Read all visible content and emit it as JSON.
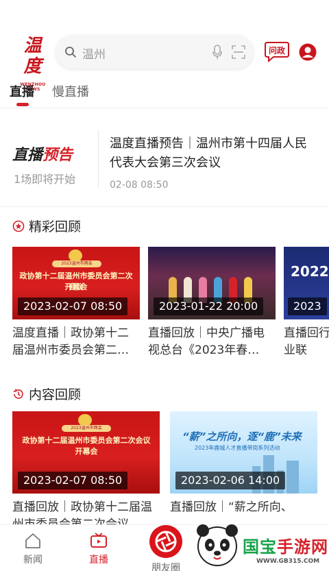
{
  "header": {
    "logo_text": "温度",
    "logo_sub": "WENZHOU NEWS",
    "search_placeholder": "温州",
    "wenzheng_label": "问政"
  },
  "tabs": [
    {
      "label": "直播",
      "active": true
    },
    {
      "label": "慢直播",
      "active": false
    }
  ],
  "notice": {
    "badge_part1": "直播",
    "badge_part2": "预告",
    "subtitle": "1场即将开始",
    "title": "温度直播预告｜温州市第十四届人民代表大会第三次会议",
    "time": "02-08  08:50"
  },
  "section_highlights": {
    "title": "精彩回顾",
    "cards": [
      {
        "thumb_line1": "政协第十二届温州市委员会第二次会议",
        "thumb_line2": "开幕会",
        "pill": "2023温州市两会",
        "timestamp": "2023-02-07  08:50",
        "title": "温度直播｜政协第十二届温州市委员会第二…"
      },
      {
        "timestamp": "2023-01-22  20:00",
        "title": "直播回放｜中央广播电视总台《2023年春…"
      },
      {
        "thumb_year": "2022",
        "timestamp": "2023",
        "title": "直播回行业联"
      }
    ]
  },
  "section_content": {
    "title": "内容回顾",
    "cards": [
      {
        "thumb_line1": "政协第十二届温州市委员会第二次会议",
        "thumb_line2": "开幕会",
        "pill": "2023温州市两会",
        "timestamp": "2023-02-07  08:50",
        "title": "直播回放｜政协第十二届温州市委员会第二次会议"
      },
      {
        "thumb_line1": "“薪”之所向，逐“鹿”未来",
        "thumb_line2": "2023年鹿城人才直播带岗系列活动",
        "timestamp": "2023-02-06  14:00",
        "title": "直播回放｜“薪之所向、"
      }
    ]
  },
  "bottom_nav": {
    "news": "新闻",
    "live": "直播",
    "friends": "朋友圈"
  },
  "watermark": {
    "text_green": "国宝",
    "text_red": "手游网",
    "url": "WWW.GB315.COM"
  },
  "colors": {
    "accent": "#d6222a",
    "text": "#222222",
    "muted": "#999999"
  }
}
